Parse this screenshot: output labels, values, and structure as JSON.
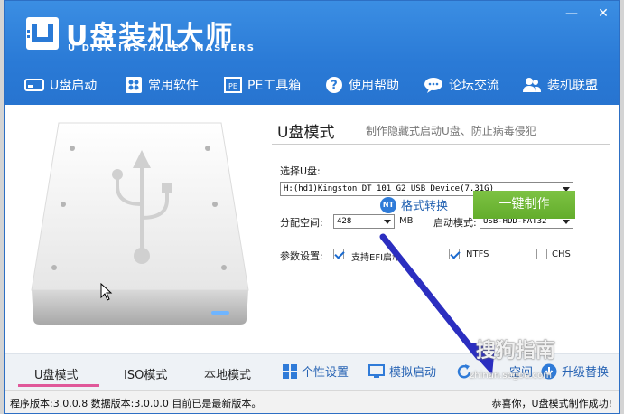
{
  "app": {
    "brand_title": "U盘装机大师",
    "brand_subtitle": "U DISK INSTALLED MASTERS",
    "min_symbol": "—",
    "close_symbol": "✕"
  },
  "nav": {
    "items": [
      {
        "label": "U盘启动",
        "icon": "usb-drive-icon"
      },
      {
        "label": "常用软件",
        "icon": "apps-icon"
      },
      {
        "label": "PE工具箱",
        "icon": "pe-toolbox-icon"
      },
      {
        "label": "使用帮助",
        "icon": "help-icon"
      },
      {
        "label": "论坛交流",
        "icon": "chat-icon"
      },
      {
        "label": "装机联盟",
        "icon": "users-icon"
      }
    ]
  },
  "mode": {
    "title": "U盘模式",
    "description": "制作隐藏式启动U盘、防止病毒侵犯"
  },
  "form": {
    "select_disk_label": "选择U盘:",
    "select_disk_value": "H:(hd1)Kingston DT 101 G2 USB Device(7.31G)",
    "alloc_label": "分配空间:",
    "alloc_value": "428",
    "alloc_unit": "MB",
    "boot_mode_label": "启动模式:",
    "boot_mode_value": "USB-HDD-FAT32",
    "params_label": "参数设置:",
    "opt_efi": "支持EFI启动",
    "opt_ntfs": "NTFS",
    "opt_chs": "CHS",
    "opt_efi_checked": true,
    "opt_ntfs_checked": true,
    "opt_chs_checked": false
  },
  "actions": {
    "convert_icon_text": "NT",
    "convert_label": "格式转换",
    "make_label": "一键制作"
  },
  "tabs": [
    {
      "label": "U盘模式"
    },
    {
      "label": "ISO模式"
    },
    {
      "label": "本地模式"
    }
  ],
  "tools": [
    {
      "label": "个性设置",
      "icon": "windows-grid-icon"
    },
    {
      "label": "模拟启动",
      "icon": "monitor-icon"
    },
    {
      "label": "空间",
      "icon": "refresh-icon"
    },
    {
      "label": "升级替换",
      "icon": "download-icon"
    }
  ],
  "status": {
    "left": "程序版本:3.0.0.8  数据版本:3.0.0.0 目前已是最新版本。",
    "right": "恭喜你，U盘模式制作成功!"
  },
  "watermark": {
    "text": "搜狗指南",
    "sub": "zhinan.sogou.com"
  },
  "colors": {
    "header": "#2a7ad6",
    "make_button": "#6bb533",
    "tab_active": "#e0589a",
    "link": "#2864b4"
  }
}
